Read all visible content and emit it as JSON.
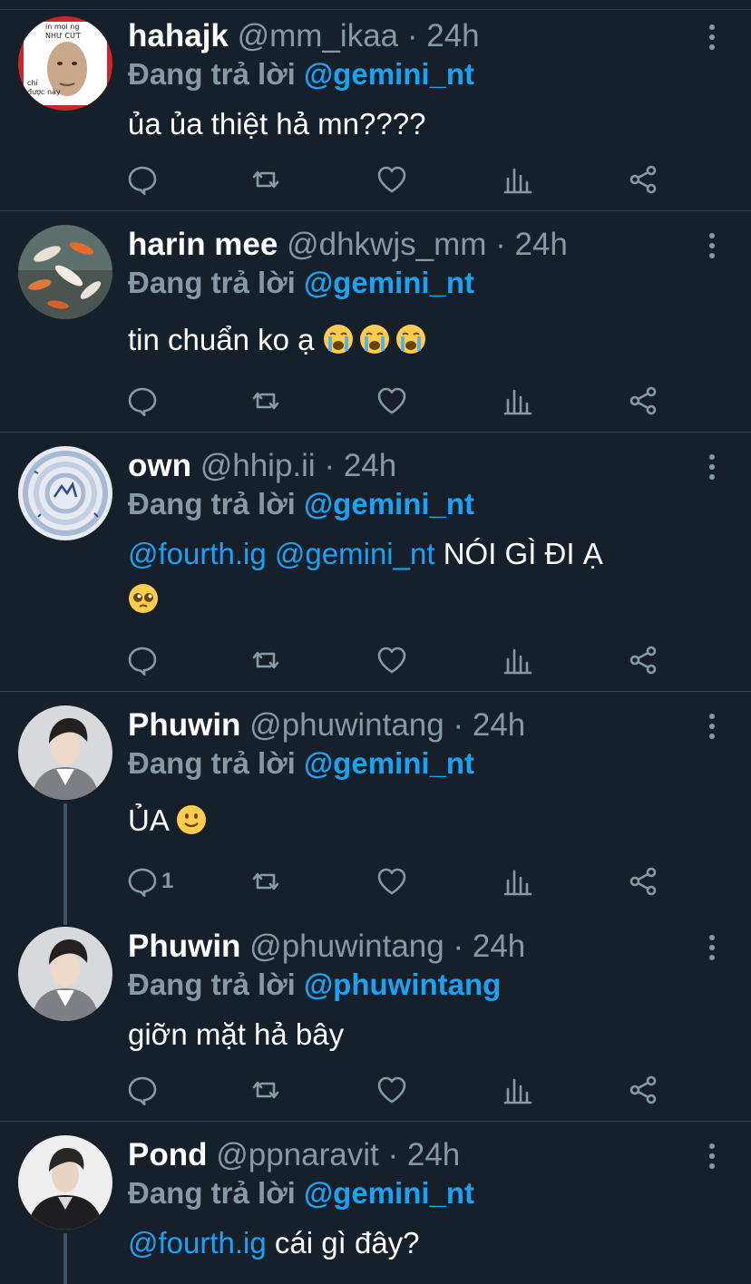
{
  "reply_prefix": "Đang trả lời",
  "tweets": [
    {
      "name": "hahajk",
      "handle": "@mm_ikaa",
      "time": "· 24h",
      "reply_to": "@gemini_nt",
      "text": "ủa ủa thiệt hả mn????",
      "avatar": "meme-avatar",
      "avatar_text": [
        "in mọi ng",
        "NHƯ CỨT",
        "chỉ",
        "được này"
      ],
      "reply_count": ""
    },
    {
      "name": "harin mee",
      "handle": "@dhkwjs_mm",
      "time": "· 24h",
      "reply_to": "@gemini_nt",
      "text": "tin chuẩn ko ạ",
      "emojis": [
        "loudly-crying-face",
        "loudly-crying-face",
        "loudly-crying-face"
      ],
      "avatar": "koi-fish-avatar",
      "reply_count": ""
    },
    {
      "name": "own",
      "handle": "@hhip.ii",
      "time": "· 24h",
      "reply_to": "@gemini_nt",
      "text_links": [
        "@fourth.ig",
        "@gemini_nt"
      ],
      "text": "NÓI GÌ ĐI Ạ",
      "emojis": [
        "pleading-face"
      ],
      "avatar": "spiral-avatar",
      "reply_count": ""
    },
    {
      "name": "Phuwin",
      "handle": "@phuwintang",
      "time": "· 24h",
      "reply_to": "@gemini_nt",
      "text": "ỦA",
      "emojis": [
        "slightly-smiling-face"
      ],
      "avatar": "portrait-avatar",
      "reply_count": "1"
    },
    {
      "name": "Phuwin",
      "handle": "@phuwintang",
      "time": "· 24h",
      "reply_to": "@phuwintang",
      "text": "giỡn mặt hả bây",
      "avatar": "portrait-avatar",
      "reply_count": ""
    },
    {
      "name": "Pond",
      "handle": "@ppnaravit",
      "time": "· 24h",
      "reply_to": "@gemini_nt",
      "text_links": [
        "@fourth.ig"
      ],
      "text": "cái gì đây?",
      "avatar": "portrait-avatar",
      "reply_count": ""
    }
  ],
  "icons": [
    "reply-icon",
    "retweet-icon",
    "like-icon",
    "analytics-icon",
    "share-icon",
    "more-options-icon"
  ],
  "colors": {
    "background": "#15202b",
    "divider": "#38444d",
    "secondary_text": "#8899a6",
    "link": "#1da1f2",
    "primary_text": "#ffffff"
  }
}
